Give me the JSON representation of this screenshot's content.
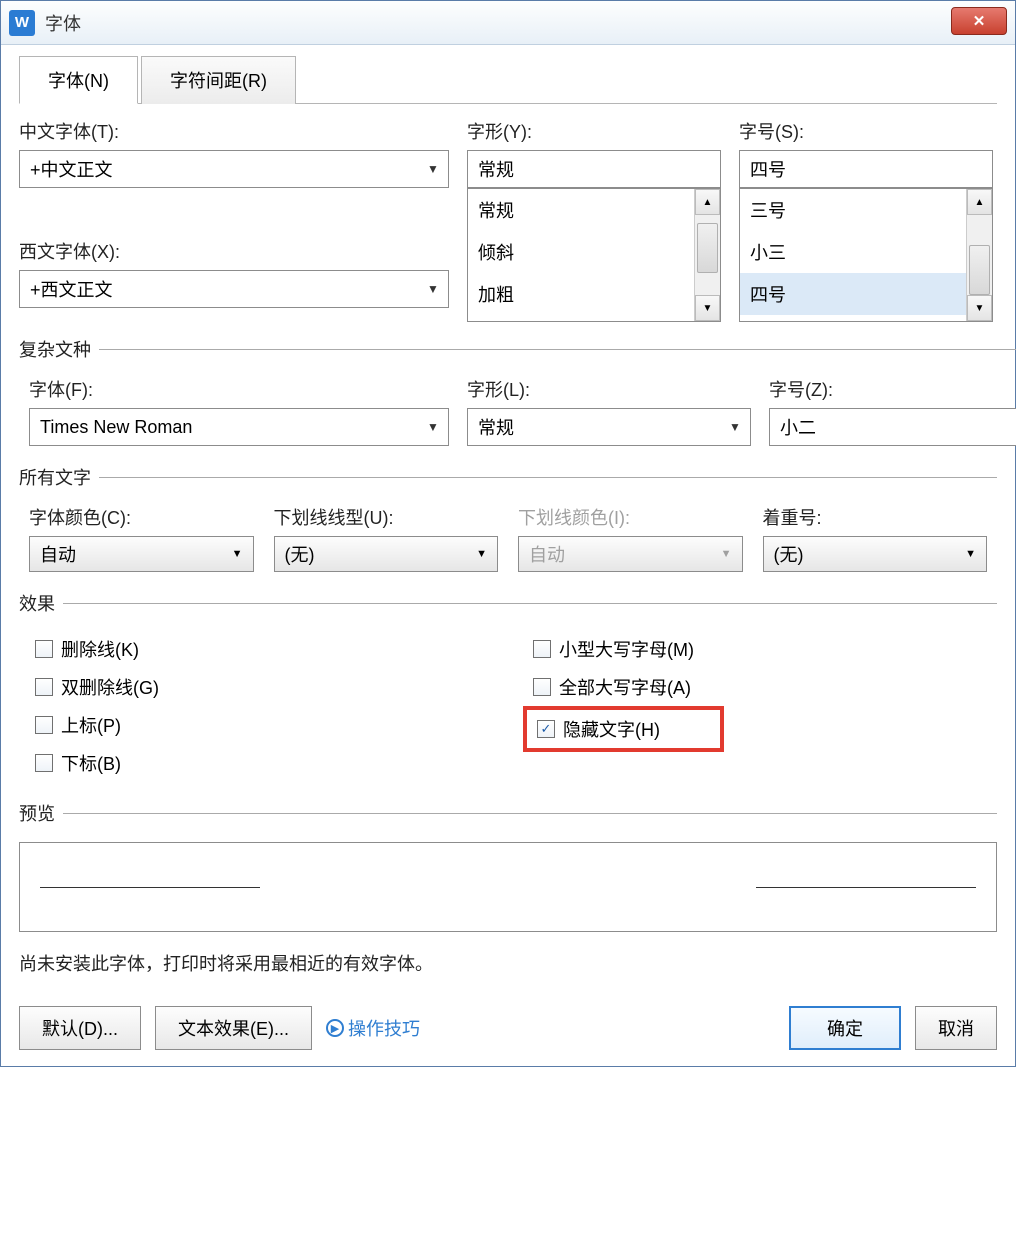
{
  "window": {
    "title": "字体",
    "app_icon_letter": "W"
  },
  "tabs": {
    "font": "字体(N)",
    "spacing": "字符间距(R)"
  },
  "cn_font": {
    "label": "中文字体(T):",
    "value": "+中文正文"
  },
  "style": {
    "label": "字形(Y):",
    "value": "常规",
    "options": [
      "常规",
      "倾斜",
      "加粗"
    ]
  },
  "size": {
    "label": "字号(S):",
    "value": "四号",
    "options": [
      "三号",
      "小三",
      "四号"
    ]
  },
  "en_font": {
    "label": "西文字体(X):",
    "value": "+西文正文"
  },
  "complex": {
    "legend": "复杂文种",
    "font_label": "字体(F):",
    "font_value": "Times New Roman",
    "style_label": "字形(L):",
    "style_value": "常规",
    "size_label": "字号(Z):",
    "size_value": "小二"
  },
  "all_text": {
    "legend": "所有文字",
    "color_label": "字体颜色(C):",
    "color_value": "自动",
    "underline_label": "下划线线型(U):",
    "underline_value": "(无)",
    "ul_color_label": "下划线颜色(I):",
    "ul_color_value": "自动",
    "emphasis_label": "着重号:",
    "emphasis_value": "(无)"
  },
  "effects": {
    "legend": "效果",
    "strike": "删除线(K)",
    "dstrike": "双删除线(G)",
    "sup": "上标(P)",
    "sub": "下标(B)",
    "smallcaps": "小型大写字母(M)",
    "allcaps": "全部大写字母(A)",
    "hidden": "隐藏文字(H)"
  },
  "preview": {
    "legend": "预览"
  },
  "message": "尚未安装此字体，打印时将采用最相近的有效字体。",
  "buttons": {
    "default": "默认(D)...",
    "text_effect": "文本效果(E)...",
    "tips": "操作技巧",
    "ok": "确定",
    "cancel": "取消"
  }
}
